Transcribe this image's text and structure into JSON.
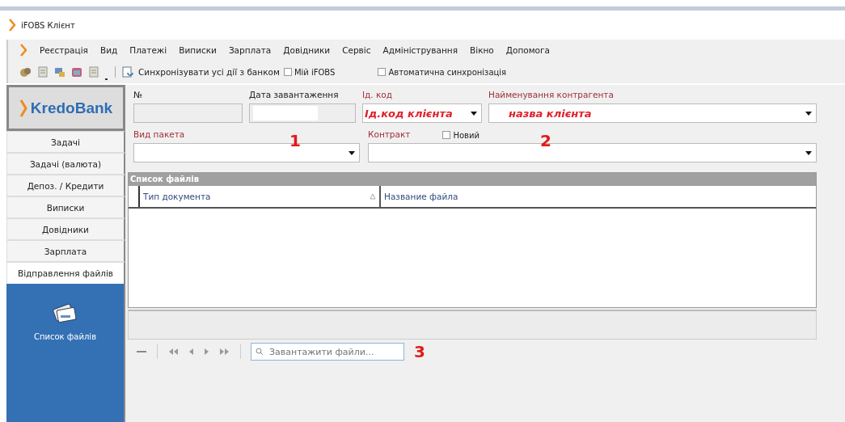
{
  "window": {
    "title": "iFOBS Клієнт"
  },
  "menu": [
    "Реєстрація",
    "Вид",
    "Платежі",
    "Виписки",
    "Зарплата",
    "Довідники",
    "Сервіс",
    "Адміністрування",
    "Вікно",
    "Допомога"
  ],
  "toolbar": {
    "sync_label": "Синхронізувати усі дії з банком",
    "checkboxes": [
      {
        "label": "Мій iFOBS",
        "checked": false
      },
      {
        "label": "Автоматична синхронізація",
        "checked": false
      }
    ]
  },
  "sidebar": {
    "logo": "KredoBank",
    "items": [
      {
        "label": "Задачі",
        "selected": false
      },
      {
        "label": "Задачі (валюта)",
        "selected": false
      },
      {
        "label": "Депоз. / Кредити",
        "selected": false
      },
      {
        "label": "Виписки",
        "selected": false
      },
      {
        "label": "Довідники",
        "selected": false
      },
      {
        "label": "Зарплата",
        "selected": false
      },
      {
        "label": "Відправлення файлів",
        "selected": true
      }
    ],
    "panel_items": [
      "Список файлів"
    ]
  },
  "form": {
    "number_label": "№",
    "date_label": "Дата завантаження",
    "id_label": "Ід. код",
    "id_value": "Ід.код клієнта",
    "name_label": "Найменування контрагента",
    "name_value": "назва клієнта",
    "package_label": "Вид пакета",
    "contract_label": "Контракт",
    "new_checkbox": {
      "label": "Новий",
      "checked": false
    }
  },
  "grid": {
    "title": "Список файлів",
    "columns": [
      "Тип документа",
      "Название файла"
    ]
  },
  "search": {
    "placeholder": "Завантажити файли..."
  },
  "markers": [
    "1",
    "2",
    "3"
  ]
}
